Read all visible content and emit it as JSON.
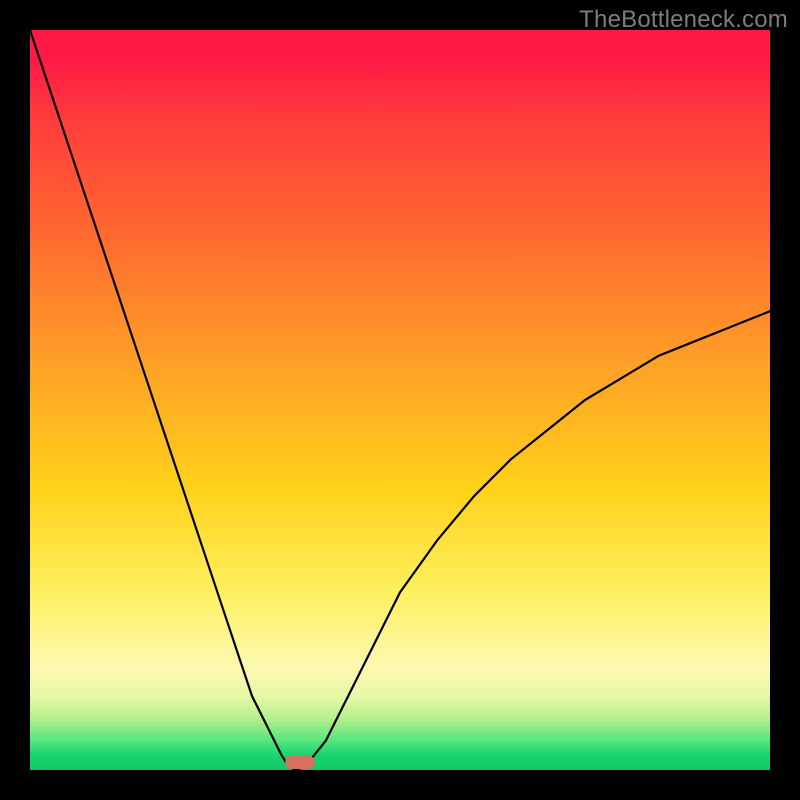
{
  "watermark": "TheBottleneck.com",
  "colors": {
    "frame": "#000000",
    "gradient_top": "#ff1a45",
    "gradient_mid": "#ffd21a",
    "gradient_bottom": "#0fc966",
    "curve": "#000000",
    "marker": "#d8705f"
  },
  "chart_data": {
    "type": "line",
    "title": "",
    "xlabel": "",
    "ylabel": "",
    "xlim": [
      0,
      100
    ],
    "ylim": [
      0,
      100
    ],
    "x": [
      0,
      2,
      4,
      6,
      8,
      10,
      12,
      14,
      16,
      18,
      20,
      22,
      24,
      26,
      28,
      30,
      32,
      34,
      35,
      36,
      37,
      38,
      40,
      42,
      44,
      46,
      48,
      50,
      55,
      60,
      65,
      70,
      75,
      80,
      85,
      90,
      95,
      100
    ],
    "series": [
      {
        "name": "bottleneck-curve",
        "values": [
          100,
          94,
          88,
          82,
          76,
          70,
          64,
          58,
          52,
          46,
          40,
          34,
          28,
          22,
          16,
          10,
          6,
          2,
          0.4,
          0,
          0.4,
          1.5,
          4,
          8,
          12,
          16,
          20,
          24,
          31,
          37,
          42,
          46,
          50,
          53,
          56,
          58,
          60,
          62
        ]
      }
    ],
    "marker": {
      "x_start": 34.5,
      "x_end": 38.5,
      "y": 0
    },
    "legend": false,
    "grid": false
  }
}
